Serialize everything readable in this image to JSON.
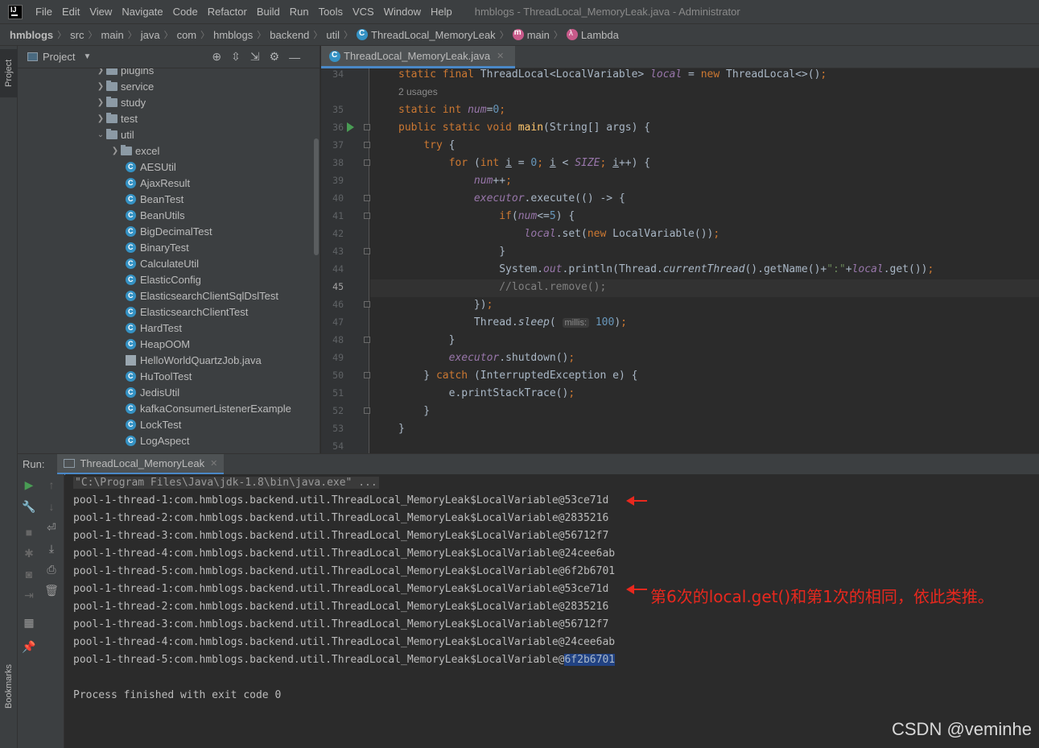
{
  "menubar": {
    "items": [
      "File",
      "Edit",
      "View",
      "Navigate",
      "Code",
      "Refactor",
      "Build",
      "Run",
      "Tools",
      "VCS",
      "Window",
      "Help"
    ],
    "window_title": "hmblogs - ThreadLocal_MemoryLeak.java - Administrator"
  },
  "breadcrumb": {
    "items": [
      "hmblogs",
      "src",
      "main",
      "java",
      "com",
      "hmblogs",
      "backend",
      "util",
      "ThreadLocal_MemoryLeak",
      "main",
      "Lambda"
    ]
  },
  "left_stripe": {
    "project": "Project",
    "bookmarks": "Bookmarks"
  },
  "project_panel": {
    "title": "Project",
    "tree": [
      {
        "label": "plugins",
        "kind": "folder",
        "level": 1,
        "expanded": false
      },
      {
        "label": "service",
        "kind": "folder",
        "level": 1,
        "expanded": false
      },
      {
        "label": "study",
        "kind": "folder",
        "level": 1,
        "expanded": false
      },
      {
        "label": "test",
        "kind": "folder",
        "level": 1,
        "expanded": false
      },
      {
        "label": "util",
        "kind": "folder",
        "level": 1,
        "expanded": true
      },
      {
        "label": "excel",
        "kind": "folder",
        "level": 2,
        "expanded": false
      },
      {
        "label": "AESUtil",
        "kind": "class",
        "level": 2
      },
      {
        "label": "AjaxResult",
        "kind": "class",
        "level": 2
      },
      {
        "label": "BeanTest",
        "kind": "class",
        "level": 2
      },
      {
        "label": "BeanUtils",
        "kind": "class",
        "level": 2
      },
      {
        "label": "BigDecimalTest",
        "kind": "class",
        "level": 2
      },
      {
        "label": "BinaryTest",
        "kind": "class",
        "level": 2
      },
      {
        "label": "CalculateUtil",
        "kind": "class",
        "level": 2
      },
      {
        "label": "ElasticConfig",
        "kind": "class",
        "level": 2
      },
      {
        "label": "ElasticsearchClientSqlDslTest",
        "kind": "class",
        "level": 2
      },
      {
        "label": "ElasticsearchClientTest",
        "kind": "class",
        "level": 2
      },
      {
        "label": "HardTest",
        "kind": "class",
        "level": 2
      },
      {
        "label": "HeapOOM",
        "kind": "class",
        "level": 2
      },
      {
        "label": "HelloWorldQuartzJob.java",
        "kind": "java",
        "level": 2
      },
      {
        "label": "HuToolTest",
        "kind": "class",
        "level": 2
      },
      {
        "label": "JedisUtil",
        "kind": "class",
        "level": 2
      },
      {
        "label": "kafkaConsumerListenerExample",
        "kind": "class",
        "level": 2
      },
      {
        "label": "LockTest",
        "kind": "class",
        "level": 2
      },
      {
        "label": "LogAspect",
        "kind": "class",
        "level": 2
      }
    ]
  },
  "editor": {
    "tab": "ThreadLocal_MemoryLeak.java",
    "line_numbers": [
      "34",
      "",
      "35",
      "36",
      "37",
      "38",
      "39",
      "40",
      "41",
      "42",
      "43",
      "44",
      "45",
      "46",
      "47",
      "48",
      "49",
      "50",
      "51",
      "52",
      "53",
      "54"
    ],
    "active_line": "45",
    "usages_hint": "2 usages",
    "inlay_hint": "millis:"
  },
  "run": {
    "label": "Run:",
    "tab": "ThreadLocal_MemoryLeak",
    "command": "\"C:\\Program Files\\Java\\jdk-1.8\\bin\\java.exe\" ...",
    "output": [
      "pool-1-thread-1:com.hmblogs.backend.util.ThreadLocal_MemoryLeak$LocalVariable@53ce71d",
      "pool-1-thread-2:com.hmblogs.backend.util.ThreadLocal_MemoryLeak$LocalVariable@2835216",
      "pool-1-thread-3:com.hmblogs.backend.util.ThreadLocal_MemoryLeak$LocalVariable@56712f7",
      "pool-1-thread-4:com.hmblogs.backend.util.ThreadLocal_MemoryLeak$LocalVariable@24cee6ab",
      "pool-1-thread-5:com.hmblogs.backend.util.ThreadLocal_MemoryLeak$LocalVariable@6f2b6701",
      "pool-1-thread-1:com.hmblogs.backend.util.ThreadLocal_MemoryLeak$LocalVariable@53ce71d",
      "pool-1-thread-2:com.hmblogs.backend.util.ThreadLocal_MemoryLeak$LocalVariable@2835216",
      "pool-1-thread-3:com.hmblogs.backend.util.ThreadLocal_MemoryLeak$LocalVariable@56712f7",
      "pool-1-thread-4:com.hmblogs.backend.util.ThreadLocal_MemoryLeak$LocalVariable@24cee6ab"
    ],
    "last_line_prefix": "pool-1-thread-5:com.hmblogs.backend.util.ThreadLocal_MemoryLeak$LocalVariable@",
    "last_line_selected": "6f2b6701",
    "exit": "Process finished with exit code 0"
  },
  "annotation": "第6次的local.get()和第1次的相同，依此类推。",
  "watermark": "CSDN @veminhe",
  "colors": {
    "annotation_red": "#e8281e",
    "selection": "#214283",
    "accent": "#4a88c7"
  }
}
